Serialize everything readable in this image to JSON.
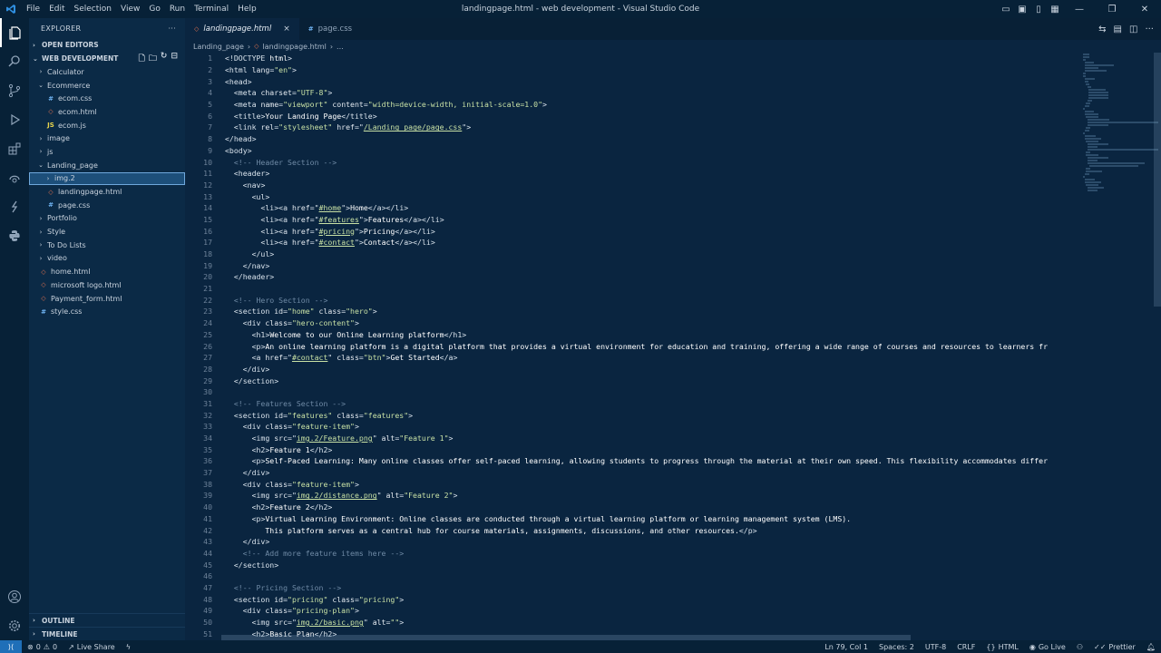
{
  "window": {
    "title": "landingpage.html - web development - Visual Studio Code",
    "menu": [
      "File",
      "Edit",
      "Selection",
      "View",
      "Go",
      "Run",
      "Terminal",
      "Help"
    ]
  },
  "sidebar": {
    "title": "EXPLORER",
    "open_editors": "OPEN EDITORS",
    "workspace": "WEB DEVELOPMENT",
    "tree": [
      {
        "label": "Calculator",
        "indent": 1,
        "type": "folder",
        "open": false
      },
      {
        "label": "Ecommerce",
        "indent": 1,
        "type": "folder",
        "open": true
      },
      {
        "label": "ecom.css",
        "indent": 2,
        "type": "css"
      },
      {
        "label": "ecom.html",
        "indent": 2,
        "type": "html"
      },
      {
        "label": "ecom.js",
        "indent": 2,
        "type": "js"
      },
      {
        "label": "image",
        "indent": 1,
        "type": "folder",
        "open": false
      },
      {
        "label": "js",
        "indent": 1,
        "type": "folder",
        "open": false
      },
      {
        "label": "Landing_page",
        "indent": 1,
        "type": "folder",
        "open": true
      },
      {
        "label": "img.2",
        "indent": 2,
        "type": "folder",
        "open": false,
        "selected": true
      },
      {
        "label": "landingpage.html",
        "indent": 2,
        "type": "html"
      },
      {
        "label": "page.css",
        "indent": 2,
        "type": "css"
      },
      {
        "label": "Portfolio",
        "indent": 1,
        "type": "folder",
        "open": false
      },
      {
        "label": "Style",
        "indent": 1,
        "type": "folder",
        "open": false
      },
      {
        "label": "To Do Lists",
        "indent": 1,
        "type": "folder",
        "open": false
      },
      {
        "label": "video",
        "indent": 1,
        "type": "folder",
        "open": false
      },
      {
        "label": "home.html",
        "indent": 1,
        "type": "html"
      },
      {
        "label": "microsoft logo.html",
        "indent": 1,
        "type": "html"
      },
      {
        "label": "Payment_form.html",
        "indent": 1,
        "type": "html"
      },
      {
        "label": "style.css",
        "indent": 1,
        "type": "css"
      }
    ],
    "outline": "OUTLINE",
    "timeline": "TIMELINE"
  },
  "tabs": [
    {
      "label": "landingpage.html",
      "active": true,
      "type": "html"
    },
    {
      "label": "page.css",
      "active": false,
      "type": "css"
    }
  ],
  "breadcrumb": [
    "Landing_page",
    "landingpage.html",
    "..."
  ],
  "code_lines": [
    "<!DOCTYPE html>",
    "<html lang=\"en\">",
    "<head>",
    "  <meta charset=\"UTF-8\">",
    "  <meta name=\"viewport\" content=\"width=device-width, initial-scale=1.0\">",
    "  <title>Your Landing Page</title>",
    "  <link rel=\"stylesheet\" href=\"/Landing_page/page.css\">",
    "</head>",
    "<body>",
    "  <!-- Header Section -->",
    "  <header>",
    "    <nav>",
    "      <ul>",
    "        <li><a href=\"#home\">Home</a></li>",
    "        <li><a href=\"#features\">Features</a></li>",
    "        <li><a href=\"#pricing\">Pricing</a></li>",
    "        <li><a href=\"#contact\">Contact</a></li>",
    "      </ul>",
    "    </nav>",
    "  </header>",
    "",
    "  <!-- Hero Section -->",
    "  <section id=\"home\" class=\"hero\">",
    "    <div class=\"hero-content\">",
    "      <h1>Welcome to our Online Learning platform</h1>",
    "      <p>An online learning platform is a digital platform that provides a virtual environment for education and training, offering a wide range of courses and resources to learners fr",
    "      <a href=\"#contact\" class=\"btn\">Get Started</a>",
    "    </div>",
    "  </section>",
    "",
    "  <!-- Features Section -->",
    "  <section id=\"features\" class=\"features\">",
    "    <div class=\"feature-item\">",
    "      <img src=\"img.2/Feature.png\" alt=\"Feature 1\">",
    "      <h2>Feature 1</h2>",
    "      <p>Self-Paced Learning: Many online classes offer self-paced learning, allowing students to progress through the material at their own speed. This flexibility accommodates differ",
    "    </div>",
    "    <div class=\"feature-item\">",
    "      <img src=\"img.2/distance.png\" alt=\"Feature 2\">",
    "      <h2>Feature 2</h2>",
    "      <p>Virtual Learning Environment: Online classes are conducted through a virtual learning platform or learning management system (LMS).",
    "         This platform serves as a central hub for course materials, assignments, discussions, and other resources.</p>",
    "    </div>",
    "    <!-- Add more feature items here -->",
    "  </section>",
    "",
    "  <!-- Pricing Section -->",
    "  <section id=\"pricing\" class=\"pricing\">",
    "    <div class=\"pricing-plan\">",
    "      <img src=\"img.2/basic.png\" alt=\"\">",
    "      <h2>Basic Plan</h2>"
  ],
  "statusbar": {
    "errors": "0",
    "warnings": "0",
    "live_share": "Live Share",
    "position": "Ln 79, Col 1",
    "spaces": "Spaces: 2",
    "encoding": "UTF-8",
    "eol": "CRLF",
    "language": "HTML",
    "go_live": "Go Live",
    "prettier": "Prettier"
  },
  "colors": {
    "background": "#0a2540",
    "activity_bar": "#072137",
    "sidebar": "#0b2a46",
    "selection": "#1d4f7a",
    "string": "#c8e1a5",
    "comment": "#6f8aa5"
  }
}
